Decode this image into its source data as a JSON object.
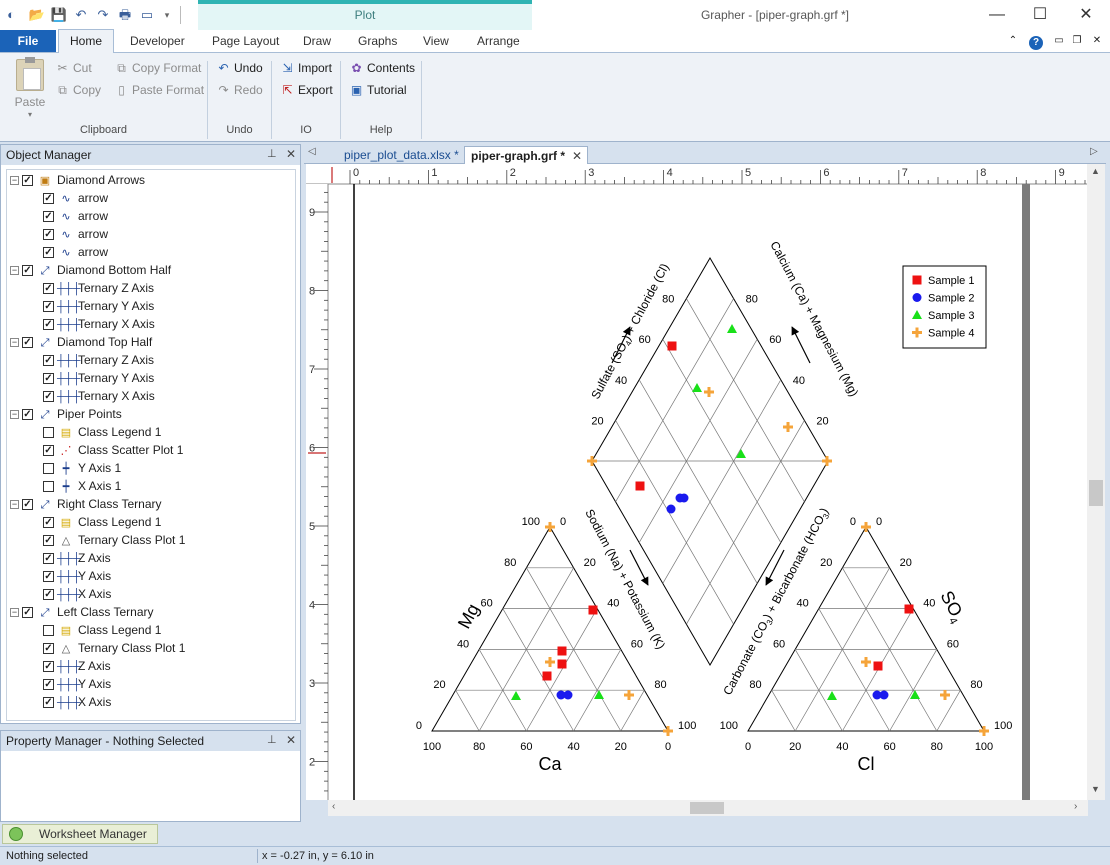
{
  "app": {
    "title": "Grapher - [piper-graph.grf *]",
    "context_tab": "Plot"
  },
  "ribbon_tabs": {
    "file": "File",
    "home": "Home",
    "developer": "Developer",
    "page_layout": "Page Layout",
    "draw": "Draw",
    "graphs": "Graphs",
    "view": "View",
    "arrange": "Arrange"
  },
  "ribbon": {
    "clipboard": {
      "paste": "Paste",
      "cut": "Cut",
      "copy": "Copy",
      "copy_format": "Copy Format",
      "paste_format": "Paste Format",
      "group": "Clipboard"
    },
    "undo": {
      "undo": "Undo",
      "redo": "Redo",
      "group": "Undo"
    },
    "io": {
      "import": "Import",
      "export": "Export",
      "group": "IO"
    },
    "help": {
      "contents": "Contents",
      "tutorial": "Tutorial",
      "group": "Help"
    }
  },
  "object_manager": {
    "title": "Object Manager",
    "items": [
      {
        "label": "Diamond Arrows",
        "level": 0,
        "checked": true,
        "icon": "group-icon"
      },
      {
        "label": "arrow",
        "level": 1,
        "checked": true,
        "icon": "polyline-icon"
      },
      {
        "label": "arrow",
        "level": 1,
        "checked": true,
        "icon": "polyline-icon"
      },
      {
        "label": "arrow",
        "level": 1,
        "checked": true,
        "icon": "polyline-icon"
      },
      {
        "label": "arrow",
        "level": 1,
        "checked": true,
        "icon": "polyline-icon"
      },
      {
        "label": "Diamond Bottom Half",
        "level": 0,
        "checked": true,
        "icon": "graph-icon"
      },
      {
        "label": "Ternary Z Axis",
        "level": 1,
        "checked": true,
        "icon": "axis-icon"
      },
      {
        "label": "Ternary Y Axis",
        "level": 1,
        "checked": true,
        "icon": "axis-icon"
      },
      {
        "label": "Ternary X Axis",
        "level": 1,
        "checked": true,
        "icon": "axis-icon"
      },
      {
        "label": "Diamond Top Half",
        "level": 0,
        "checked": true,
        "icon": "graph-icon"
      },
      {
        "label": "Ternary Z Axis",
        "level": 1,
        "checked": true,
        "icon": "axis-icon"
      },
      {
        "label": "Ternary Y Axis",
        "level": 1,
        "checked": true,
        "icon": "axis-icon"
      },
      {
        "label": "Ternary X Axis",
        "level": 1,
        "checked": true,
        "icon": "axis-icon"
      },
      {
        "label": "Piper Points",
        "level": 0,
        "checked": true,
        "icon": "graph-icon"
      },
      {
        "label": "Class Legend 1",
        "level": 1,
        "checked": false,
        "icon": "legend-icon"
      },
      {
        "label": "Class Scatter Plot 1",
        "level": 1,
        "checked": true,
        "icon": "scatter-icon"
      },
      {
        "label": "Y Axis 1",
        "level": 1,
        "checked": false,
        "icon": "y-axis-icon"
      },
      {
        "label": "X Axis 1",
        "level": 1,
        "checked": false,
        "icon": "x-axis-icon"
      },
      {
        "label": "Right Class Ternary",
        "level": 0,
        "checked": true,
        "icon": "graph-icon"
      },
      {
        "label": "Class Legend 1",
        "level": 1,
        "checked": true,
        "icon": "legend-icon"
      },
      {
        "label": "Ternary Class Plot 1",
        "level": 1,
        "checked": true,
        "icon": "ternary-icon"
      },
      {
        "label": "Z Axis",
        "level": 1,
        "checked": true,
        "icon": "axis-icon"
      },
      {
        "label": "Y Axis",
        "level": 1,
        "checked": true,
        "icon": "axis-icon"
      },
      {
        "label": "X Axis",
        "level": 1,
        "checked": true,
        "icon": "axis-icon"
      },
      {
        "label": "Left Class Ternary",
        "level": 0,
        "checked": true,
        "icon": "graph-icon"
      },
      {
        "label": "Class Legend 1",
        "level": 1,
        "checked": false,
        "icon": "legend-icon"
      },
      {
        "label": "Ternary Class Plot 1",
        "level": 1,
        "checked": true,
        "icon": "ternary-icon"
      },
      {
        "label": "Z Axis",
        "level": 1,
        "checked": true,
        "icon": "axis-icon"
      },
      {
        "label": "Y Axis",
        "level": 1,
        "checked": true,
        "icon": "axis-icon"
      },
      {
        "label": "X Axis",
        "level": 1,
        "checked": true,
        "icon": "axis-icon"
      }
    ]
  },
  "property_manager": {
    "title": "Property Manager - Nothing Selected"
  },
  "doc_tabs": {
    "tab1": "piper_plot_data.xlsx *",
    "tab2": "piper-graph.grf *"
  },
  "rulers": {
    "top": [
      "0",
      "1",
      "2",
      "3",
      "4",
      "5",
      "6",
      "7",
      "8",
      "9"
    ],
    "left": [
      "9",
      "8",
      "7",
      "6",
      "5",
      "4",
      "3",
      "2"
    ]
  },
  "graph": {
    "diamond_labels": {
      "top_left": "Sulfate (SO4) + Chloride (Cl)",
      "top_right": "Calcium (Ca) + Magnesium (Mg)",
      "bottom_left": "Sodium (Na) + Potassium (K)",
      "bottom_right": "Carbonate (CO3) + Bicarbonate (HCO3)"
    },
    "diamond_ticks_left": [
      "80",
      "60",
      "40",
      "20"
    ],
    "diamond_ticks_right": [
      "80",
      "60",
      "40",
      "20"
    ],
    "left_ternary": {
      "bottom_label": "Ca",
      "side_label": "Mg",
      "bottom_ticks": [
        "100",
        "80",
        "60",
        "40",
        "20",
        "0"
      ],
      "left_ticks": [
        "0",
        "20",
        "40",
        "60",
        "80",
        "100"
      ],
      "right_ticks": [
        "0",
        "20",
        "40",
        "60",
        "80",
        "100"
      ]
    },
    "right_ternary": {
      "bottom_label": "Cl",
      "side_label": "SO4",
      "bottom_ticks": [
        "0",
        "20",
        "40",
        "60",
        "80",
        "100"
      ],
      "left_ticks": [
        "100",
        "80",
        "60",
        "40",
        "20",
        "0"
      ],
      "right_ticks": [
        "0",
        "20",
        "40",
        "60",
        "80",
        "100"
      ]
    },
    "legend": [
      {
        "label": "Sample 1",
        "color": "#ee1111",
        "marker": "square"
      },
      {
        "label": "Sample 2",
        "color": "#1a1aee",
        "marker": "circle"
      },
      {
        "label": "Sample 3",
        "color": "#19e019",
        "marker": "triangle"
      },
      {
        "label": "Sample 4",
        "color": "#f5a43a",
        "marker": "plus"
      }
    ]
  },
  "worksheet_manager": {
    "label": "Worksheet Manager"
  },
  "status": {
    "left": "Nothing selected",
    "coords": "x = -0.27 in, y = 6.10 in"
  }
}
